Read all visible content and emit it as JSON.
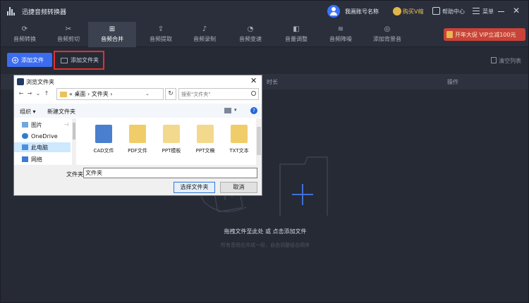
{
  "app": {
    "title": "迅捷音频转换器",
    "account_name": "我画账号名称",
    "vip_label": "购买V缩",
    "help_label": "帮助中心",
    "menu_label": "菜单",
    "close_glyph": "✕"
  },
  "tabs": [
    {
      "label": "音频转换",
      "icon": "convert-icon",
      "glyph": "⟳"
    },
    {
      "label": "音频剪切",
      "icon": "scissors-icon",
      "glyph": "✂"
    },
    {
      "label": "音频合并",
      "icon": "merge-icon",
      "glyph": "⊞",
      "active": true
    },
    {
      "label": "音频提取",
      "icon": "extract-icon",
      "glyph": "⇪"
    },
    {
      "label": "音频录制",
      "icon": "microphone-icon",
      "glyph": "♪"
    },
    {
      "label": "音频变速",
      "icon": "speed-icon",
      "glyph": "◔"
    },
    {
      "label": "音量调整",
      "icon": "volume-icon",
      "glyph": "◧"
    },
    {
      "label": "音频降噪",
      "icon": "denoise-icon",
      "glyph": "≋"
    },
    {
      "label": "添加背景音",
      "icon": "background-music-icon",
      "glyph": "◎"
    }
  ],
  "promo": {
    "label": "开年大促 VIP立减100元"
  },
  "toolbar": {
    "add_file_label": "添加文件",
    "add_folder_label": "添加文件夹",
    "clear_list_label": "清空列表"
  },
  "list": {
    "col_duration": "时长",
    "col_action": "操作"
  },
  "empty_state": {
    "title": "拖拽文件至此处 或 点击添加文件",
    "subtitle": "所有音频合并成一段，自由调整组合顺序"
  },
  "dialog": {
    "title": "浏览文件夹",
    "close_glyph": "✕",
    "nav_back": "←",
    "nav_forward": "→",
    "nav_dropdown": "⌄",
    "nav_up": "↑",
    "path": "«  桌面  ›  文件夹  ›",
    "path_dropdown": "⌄",
    "refresh_glyph": "↻",
    "search_placeholder": "搜索\"文件夹\"",
    "organize_label": "组织 ▾",
    "new_folder_label": "新建文件夹",
    "view_caret": "▾",
    "help_glyph": "?",
    "sidebar": [
      {
        "label": "图片",
        "icon": "pictures-icon",
        "color": "#6fa8dc",
        "pinned": true
      },
      {
        "label": "OneDrive",
        "icon": "onedrive-icon",
        "color": "#2b7cd3"
      },
      {
        "label": "此电脑",
        "icon": "computer-icon",
        "color": "#4a90e2",
        "selected": true
      },
      {
        "label": "网络",
        "icon": "network-icon",
        "color": "#3a7bd5"
      }
    ],
    "pin_glyph": "⊣",
    "files": [
      {
        "label": "CAD文件",
        "icon": "cad-folder-icon",
        "thumb_color": "#4a7fd0"
      },
      {
        "label": "PDF文件",
        "icon": "pdf-folder-icon",
        "thumb_color": "#f1cd6a"
      },
      {
        "label": "PPT模板",
        "icon": "ppt-template-folder-icon",
        "thumb_color": "#f3d98d"
      },
      {
        "label": "PPT文稿",
        "icon": "ppt-doc-folder-icon",
        "thumb_color": "#f3d98d"
      },
      {
        "label": "TXT文本",
        "icon": "txt-folder-icon",
        "thumb_color": "#f1cd6a"
      }
    ],
    "folder_label": "文件夹:",
    "folder_value": "文件夹",
    "select_label": "选择文件夹",
    "cancel_label": "取消"
  }
}
